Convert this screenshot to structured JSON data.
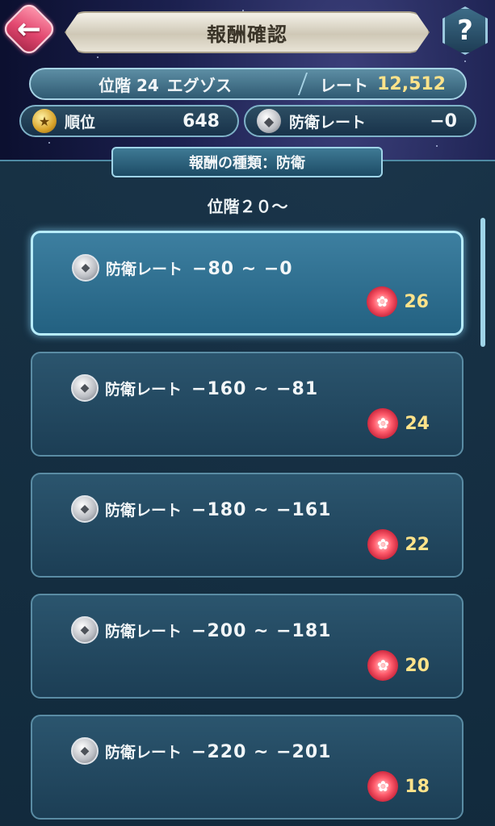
{
  "header": {
    "back_icon": "back-arrow-icon",
    "back_glyph": "←",
    "title": "報酬確認",
    "help_glyph": "?"
  },
  "rank": {
    "tier_label": "位階 24",
    "tier_name": "エグゾス",
    "rate_label": "レート",
    "rate_value": "12,512"
  },
  "stats": {
    "rank_label": "順位",
    "rank_value": "648",
    "defense_label": "防衛レート",
    "defense_value": "−0"
  },
  "panel": {
    "type_label": "報酬の種類：防衛",
    "tier_heading": "位階２０～"
  },
  "rewards": [
    {
      "label": "防衛レート",
      "range": "−80 ~ −0",
      "count": "26",
      "selected": true
    },
    {
      "label": "防衛レート",
      "range": "−160 ~ −81",
      "count": "24",
      "selected": false
    },
    {
      "label": "防衛レート",
      "range": "−180 ~ −161",
      "count": "22",
      "selected": false
    },
    {
      "label": "防衛レート",
      "range": "−200 ~ −181",
      "count": "20",
      "selected": false
    },
    {
      "label": "防衛レート",
      "range": "−220 ~ −201",
      "count": "18",
      "selected": false
    }
  ],
  "colors": {
    "accent_cyan": "#9fd4e8",
    "reward_gold": "#ffe38a",
    "back_pink": "#e2476f"
  }
}
